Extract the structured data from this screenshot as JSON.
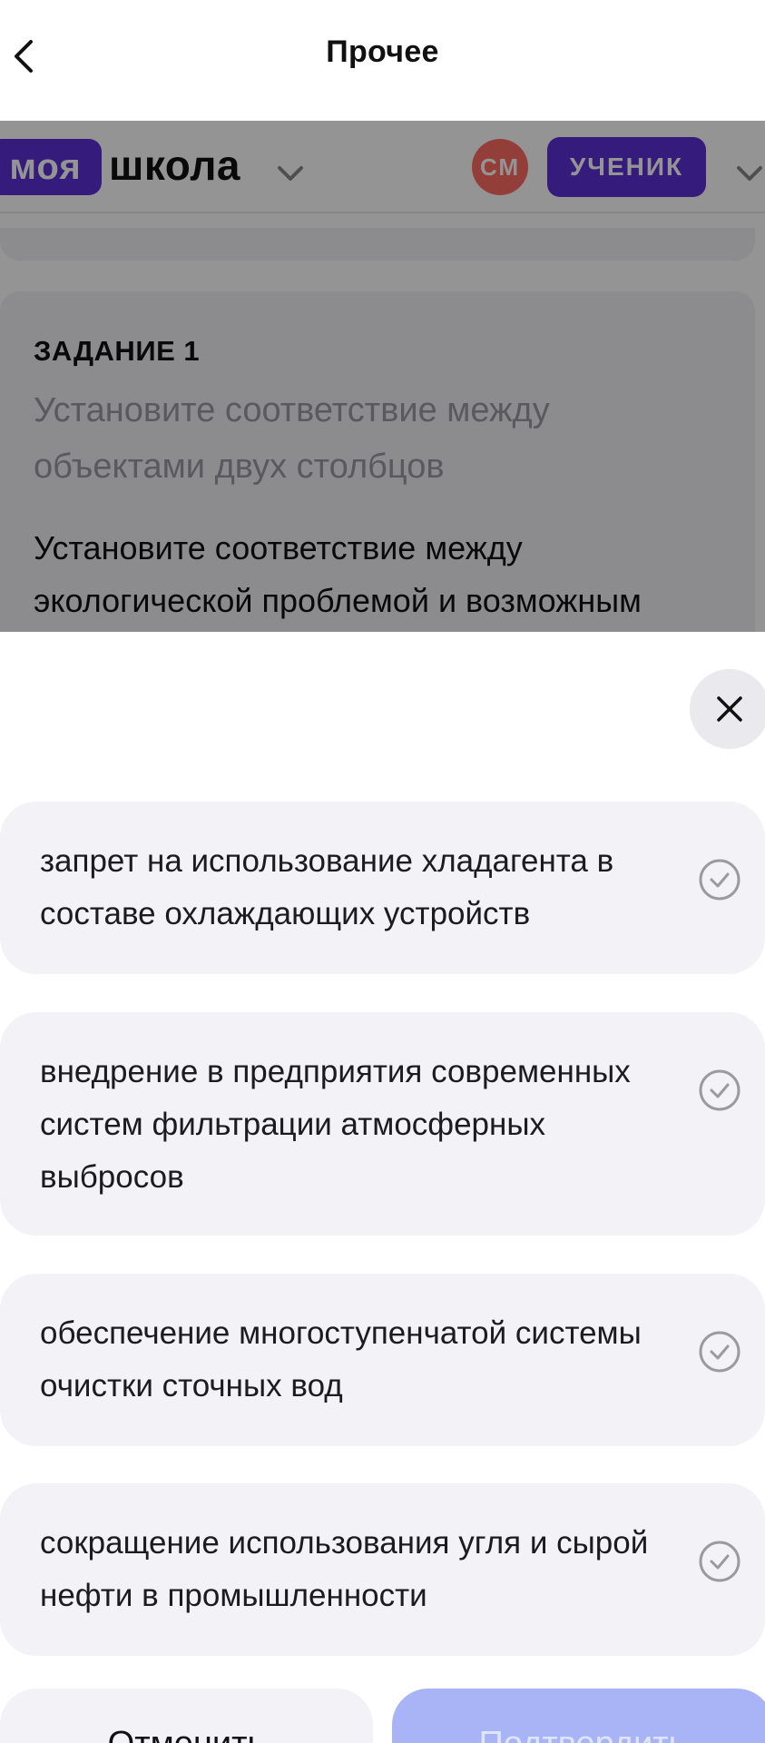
{
  "navbar": {
    "title": "Прочее",
    "back_icon": "chevron-left-icon"
  },
  "site": {
    "logo_badge": "моя",
    "logo_text": "школа",
    "avatar_initials": "СМ",
    "role": "УЧЕНИК",
    "task": {
      "title": "ЗАДАНИЕ 1",
      "subtitle": "Установите соответствие между объектами двух столбцов",
      "text": "Установите соответствие между экологической проблемой и возможным"
    }
  },
  "sheet": {
    "close_icon": "close-icon",
    "options": [
      {
        "label": "запрет на использование хладагента в составе охлаждающих устройств",
        "icon": "check-circle-icon"
      },
      {
        "label": "внедрение в предприятия современных систем фильтрации атмосферных выбросов",
        "icon": "check-circle-icon"
      },
      {
        "label": "обеспечение многоступенчатой системы очистки сточных вод",
        "icon": "check-circle-icon"
      },
      {
        "label": "сокращение использования угля и сырой нефти в промышленности",
        "icon": "check-circle-icon"
      }
    ],
    "cancel_label": "Отменить",
    "confirm_label": "Подтвердить"
  },
  "colors": {
    "brand_purple": "#5b2fd6",
    "avatar_red": "#ff6b62",
    "option_bg": "#f2f2f7",
    "confirm_disabled": "#a8b4f6"
  }
}
